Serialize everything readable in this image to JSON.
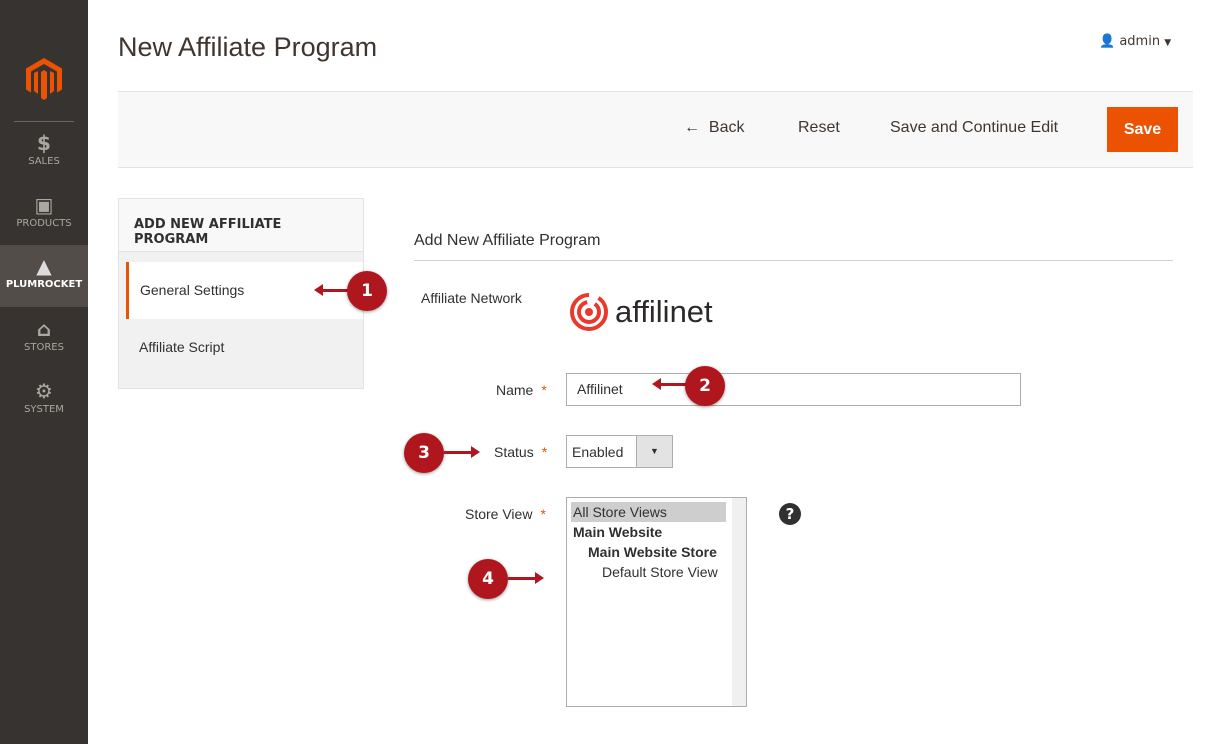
{
  "sidebar": {
    "items": [
      {
        "label": "SALES",
        "icon": "dollar-icon"
      },
      {
        "label": "PRODUCTS",
        "icon": "box-icon"
      },
      {
        "label": "PLUMROCKET",
        "icon": "pyramid-icon",
        "active": true
      },
      {
        "label": "STORES",
        "icon": "store-icon"
      },
      {
        "label": "SYSTEM",
        "icon": "gear-icon"
      }
    ]
  },
  "header": {
    "title": "New Affiliate Program",
    "user": "admin"
  },
  "toolbar": {
    "back": "Back",
    "reset": "Reset",
    "save_continue": "Save and Continue Edit",
    "save": "Save"
  },
  "tabs": {
    "title": "ADD NEW AFFILIATE PROGRAM",
    "items": [
      "General Settings",
      "Affiliate Script"
    ]
  },
  "form": {
    "section": "Add New Affiliate Program",
    "network_label": "Affiliate Network",
    "network_logo": "affilinet",
    "name_label": "Name",
    "name_value": "Affilinet",
    "status_label": "Status",
    "status_value": "Enabled",
    "store_label": "Store View",
    "store_options": [
      "All Store Views",
      "Main Website",
      "Main Website Store",
      "Default Store View"
    ],
    "required": "*",
    "help": "?"
  },
  "callouts": [
    "1",
    "2",
    "3",
    "4"
  ],
  "colors": {
    "accent": "#eb5202",
    "sidebar": "#373330",
    "callout": "#b0161d"
  }
}
